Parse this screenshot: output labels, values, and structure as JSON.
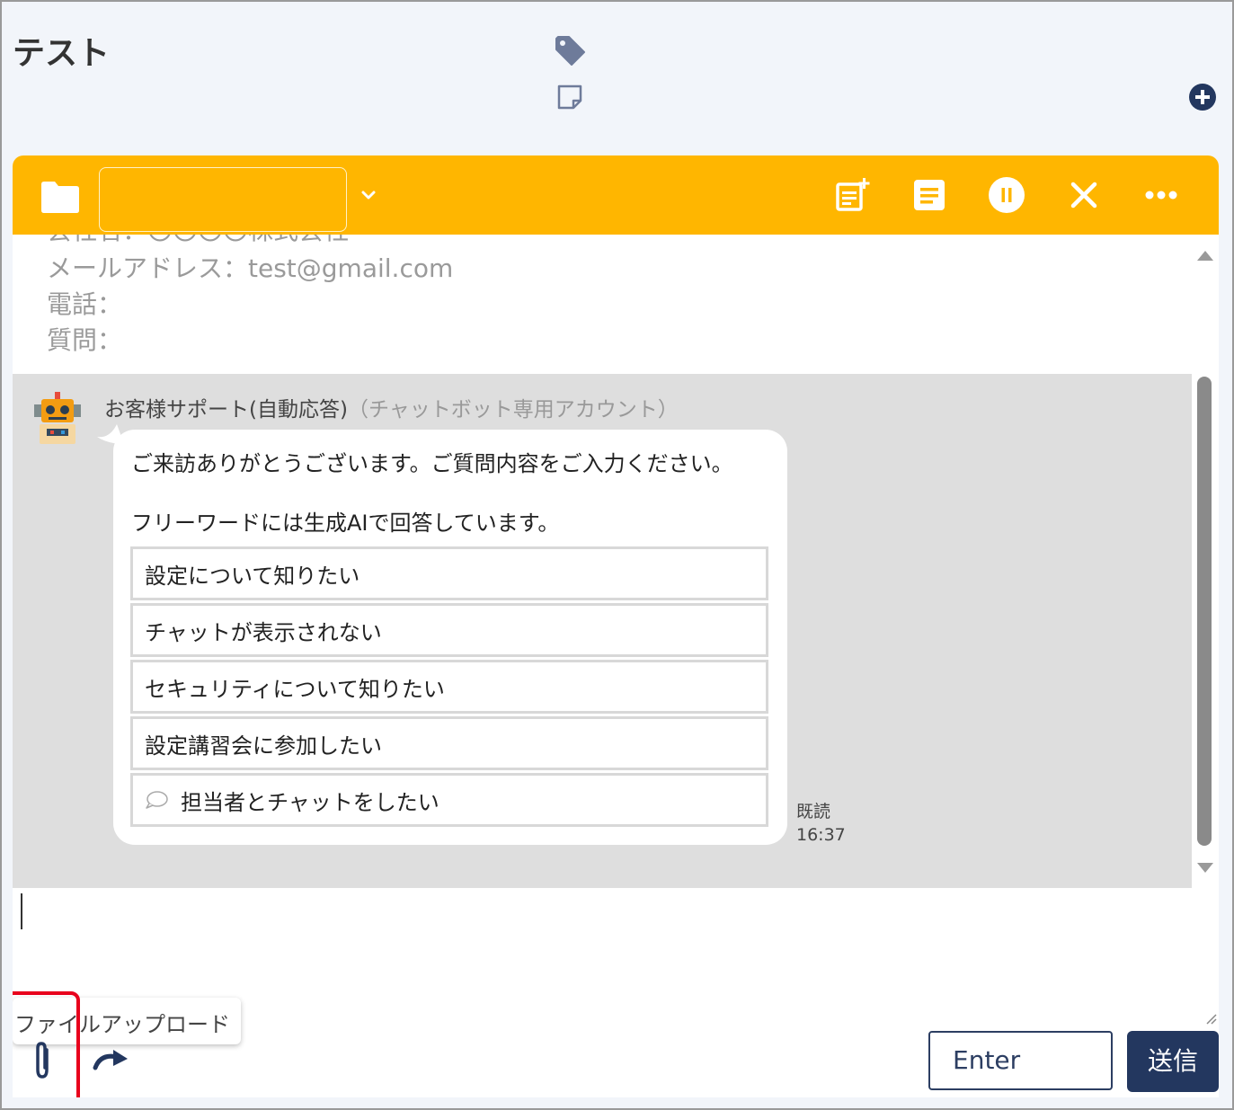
{
  "header": {
    "title": "テスト"
  },
  "toolbar": {
    "background": "#ffb600",
    "name_value": ""
  },
  "info": {
    "cut_line": "会社名：〇〇〇〇株式会社",
    "email": "メールアドレス：test@gmail.com",
    "phone": "電話：",
    "question": "質問："
  },
  "message": {
    "sender_name": "お客様サポート(自動応答)",
    "sender_sub": "（チャットボット専用アカウント）",
    "text_1": "ご来訪ありがとうございます。ご質問内容をご入力ください。",
    "text_2": "フリーワードには生成AIで回答しています。",
    "options": [
      {
        "label": "設定について知りたい"
      },
      {
        "label": "チャットが表示されない"
      },
      {
        "label": "セキュリティについて知りたい"
      },
      {
        "label": "設定講習会に参加したい"
      },
      {
        "label": "担当者とチャットをしたい",
        "icon": "speech-bubble-icon"
      }
    ],
    "read_label": "既読",
    "time": "16:37"
  },
  "composer": {
    "tooltip": "ファイルアップロード",
    "enter_label": "Enter",
    "send_label": "送信"
  },
  "colors": {
    "accent": "#ffb600",
    "navy": "#23375f",
    "highlight": "#e8001c"
  }
}
